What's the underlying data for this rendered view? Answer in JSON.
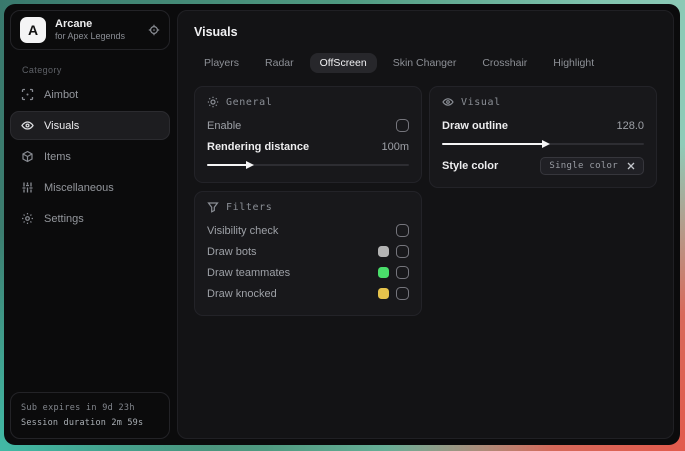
{
  "sidebar": {
    "logo_letter": "A",
    "app_name": "Arcane",
    "app_subtitle": "for Apex Legends",
    "category_label": "Category",
    "items": [
      {
        "label": "Aimbot",
        "icon": "crosshair-icon",
        "active": false
      },
      {
        "label": "Visuals",
        "icon": "eye-icon",
        "active": true
      },
      {
        "label": "Items",
        "icon": "package-icon",
        "active": false
      },
      {
        "label": "Miscellaneous",
        "icon": "sliders-icon",
        "active": false
      },
      {
        "label": "Settings",
        "icon": "gear-icon",
        "active": false
      }
    ],
    "status": {
      "line1": "Sub expires in 9d 23h",
      "line2": "Session duration 2m 59s"
    }
  },
  "main": {
    "title": "Visuals",
    "tabs": [
      {
        "label": "Players",
        "active": false
      },
      {
        "label": "Radar",
        "active": false
      },
      {
        "label": "OffScreen",
        "active": true
      },
      {
        "label": "Skin Changer",
        "active": false
      },
      {
        "label": "Crosshair",
        "active": false
      },
      {
        "label": "Highlight",
        "active": false
      }
    ],
    "panels": {
      "general": {
        "title": "General",
        "enable_label": "Enable",
        "enable_checked": false,
        "rendering_label": "Rendering distance",
        "rendering_value": "100m",
        "rendering_fill": "20%"
      },
      "visual": {
        "title": "Visual",
        "outline_label": "Draw outline",
        "outline_value": "128.0",
        "outline_fill": "50%",
        "style_label": "Style color",
        "style_value": "Single color"
      },
      "filters": {
        "title": "Filters",
        "rows": [
          {
            "label": "Visibility check",
            "swatch": null,
            "checked": false
          },
          {
            "label": "Draw bots",
            "swatch": "#b3b3b3",
            "checked": false
          },
          {
            "label": "Draw teammates",
            "swatch": "#4ade6b",
            "checked": false
          },
          {
            "label": "Draw knocked",
            "swatch": "#e6c34c",
            "checked": false
          }
        ]
      }
    }
  },
  "colors": {
    "accent_green": "#4ade6b",
    "accent_yellow": "#e6c34c",
    "accent_gray": "#b3b3b3",
    "desktop_teal": "#4f9a80",
    "desktop_red": "#e4584a"
  }
}
